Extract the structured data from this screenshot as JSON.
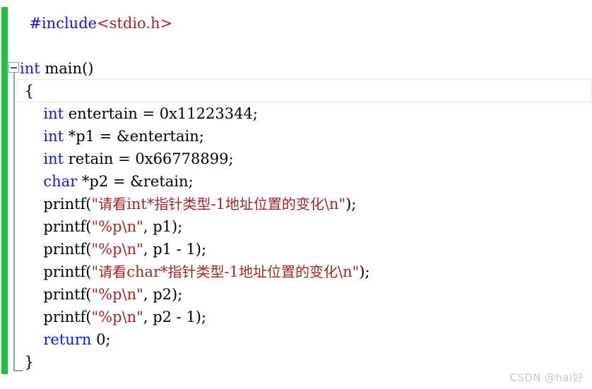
{
  "editor": {
    "language": "c",
    "colors": {
      "background": "#ffffff",
      "keyword": "#1515e0",
      "preprocessor": "#1515e0",
      "string": "#9b2727",
      "plain": "#000000",
      "change_bar_green": "#20c03a",
      "guide_gray": "#9a9a9a",
      "current_line_border": "#e6e6e6",
      "watermark": "#c7c7c7"
    },
    "gutter": {
      "collapse_icon": "collapse-minus-icon",
      "collapse_state": "expanded"
    },
    "current_line_number": 4
  },
  "code": {
    "lines": [
      {
        "n": 1,
        "text": "  #include<stdio.h>",
        "tokens": [
          {
            "t": "  ",
            "c": "plain"
          },
          {
            "t": "#include",
            "c": "preprocessor"
          },
          {
            "t": "<stdio.h>",
            "c": "string"
          }
        ]
      },
      {
        "n": 2,
        "text": "",
        "tokens": []
      },
      {
        "n": 3,
        "text": "int main()",
        "tokens": [
          {
            "t": "int",
            "c": "keyword"
          },
          {
            "t": " main()",
            "c": "plain"
          }
        ]
      },
      {
        "n": 4,
        "text": " {",
        "tokens": [
          {
            "t": " {",
            "c": "plain"
          }
        ]
      },
      {
        "n": 5,
        "text": "     int entertain = 0x11223344;",
        "tokens": [
          {
            "t": "     ",
            "c": "plain"
          },
          {
            "t": "int",
            "c": "keyword"
          },
          {
            "t": " entertain = 0x11223344;",
            "c": "plain"
          }
        ]
      },
      {
        "n": 6,
        "text": "     int *p1 = &entertain;",
        "tokens": [
          {
            "t": "     ",
            "c": "plain"
          },
          {
            "t": "int",
            "c": "keyword"
          },
          {
            "t": " *p1 = &entertain;",
            "c": "plain"
          }
        ]
      },
      {
        "n": 7,
        "text": "     int retain = 0x66778899;",
        "tokens": [
          {
            "t": "     ",
            "c": "plain"
          },
          {
            "t": "int",
            "c": "keyword"
          },
          {
            "t": " retain = 0x66778899;",
            "c": "plain"
          }
        ]
      },
      {
        "n": 8,
        "text": "     char *p2 = &retain;",
        "tokens": [
          {
            "t": "     ",
            "c": "plain"
          },
          {
            "t": "char",
            "c": "keyword"
          },
          {
            "t": " *p2 = &retain;",
            "c": "plain"
          }
        ]
      },
      {
        "n": 9,
        "text": "     printf(\"请看int*指针类型-1地址位置的变化\\n\");",
        "tokens": [
          {
            "t": "     printf(",
            "c": "plain"
          },
          {
            "t": "\"请看int*指针类型-1地址位置的变化\\n\"",
            "c": "string"
          },
          {
            "t": ");",
            "c": "plain"
          }
        ]
      },
      {
        "n": 10,
        "text": "     printf(\"%p\\n\", p1);",
        "tokens": [
          {
            "t": "     printf(",
            "c": "plain"
          },
          {
            "t": "\"%p\\n\"",
            "c": "string"
          },
          {
            "t": ", p1);",
            "c": "plain"
          }
        ]
      },
      {
        "n": 11,
        "text": "     printf(\"%p\\n\", p1 - 1);",
        "tokens": [
          {
            "t": "     printf(",
            "c": "plain"
          },
          {
            "t": "\"%p\\n\"",
            "c": "string"
          },
          {
            "t": ", p1 - 1);",
            "c": "plain"
          }
        ]
      },
      {
        "n": 12,
        "text": "     printf(\"请看char*指针类型-1地址位置的变化\\n\");",
        "tokens": [
          {
            "t": "     printf(",
            "c": "plain"
          },
          {
            "t": "\"请看char*指针类型-1地址位置的变化\\n\"",
            "c": "string"
          },
          {
            "t": ");",
            "c": "plain"
          }
        ]
      },
      {
        "n": 13,
        "text": "     printf(\"%p\\n\", p2);",
        "tokens": [
          {
            "t": "     printf(",
            "c": "plain"
          },
          {
            "t": "\"%p\\n\"",
            "c": "string"
          },
          {
            "t": ", p2);",
            "c": "plain"
          }
        ]
      },
      {
        "n": 14,
        "text": "     printf(\"%p\\n\", p2 - 1);",
        "tokens": [
          {
            "t": "     printf(",
            "c": "plain"
          },
          {
            "t": "\"%p\\n\"",
            "c": "string"
          },
          {
            "t": ", p2 - 1);",
            "c": "plain"
          }
        ]
      },
      {
        "n": 15,
        "text": "     return 0;",
        "tokens": [
          {
            "t": "     ",
            "c": "plain"
          },
          {
            "t": "return",
            "c": "keyword"
          },
          {
            "t": " 0;",
            "c": "plain"
          }
        ]
      },
      {
        "n": 16,
        "text": " }",
        "tokens": [
          {
            "t": " }",
            "c": "plain"
          }
        ]
      }
    ]
  },
  "watermark": {
    "text": "CSDN @hai好"
  }
}
